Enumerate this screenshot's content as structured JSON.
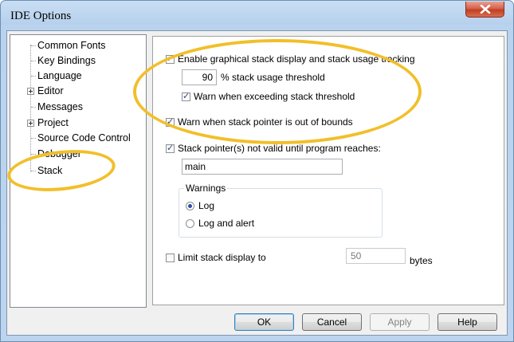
{
  "window": {
    "title": "IDE Options"
  },
  "tree": {
    "items": [
      {
        "label": "Common Fonts",
        "expandable": false
      },
      {
        "label": "Key Bindings",
        "expandable": false
      },
      {
        "label": "Language",
        "expandable": false
      },
      {
        "label": "Editor",
        "expandable": true
      },
      {
        "label": "Messages",
        "expandable": false
      },
      {
        "label": "Project",
        "expandable": true
      },
      {
        "label": "Source Code Control",
        "expandable": false
      },
      {
        "label": "Debugger",
        "expandable": false
      },
      {
        "label": "Stack",
        "expandable": false,
        "selected": true
      }
    ]
  },
  "stack_page": {
    "enable_graphical": {
      "label": "Enable graphical stack display and stack usage tracking",
      "checked": true
    },
    "threshold": {
      "value": "90",
      "label": "% stack usage threshold"
    },
    "warn_threshold": {
      "label": "Warn when exceeding stack threshold",
      "checked": true
    },
    "warn_out_of_bounds": {
      "label": "Warn when stack pointer is out of bounds",
      "checked": true
    },
    "sp_not_valid": {
      "label": "Stack pointer(s) not valid until program reaches:",
      "checked": true
    },
    "sp_label_value": "main",
    "warnings": {
      "title": "Warnings",
      "options": [
        {
          "label": "Log",
          "selected": true
        },
        {
          "label": "Log and alert",
          "selected": false
        }
      ]
    },
    "limit_display": {
      "label": "Limit stack display to",
      "checked": false,
      "value": "50",
      "unit": "bytes"
    }
  },
  "buttons": {
    "ok": "OK",
    "cancel": "Cancel",
    "apply": "Apply",
    "help": "Help"
  },
  "colors": {
    "highlight": "#f2bf2a",
    "title_bar": "#b9d3ee",
    "close_button": "#c8452a"
  }
}
